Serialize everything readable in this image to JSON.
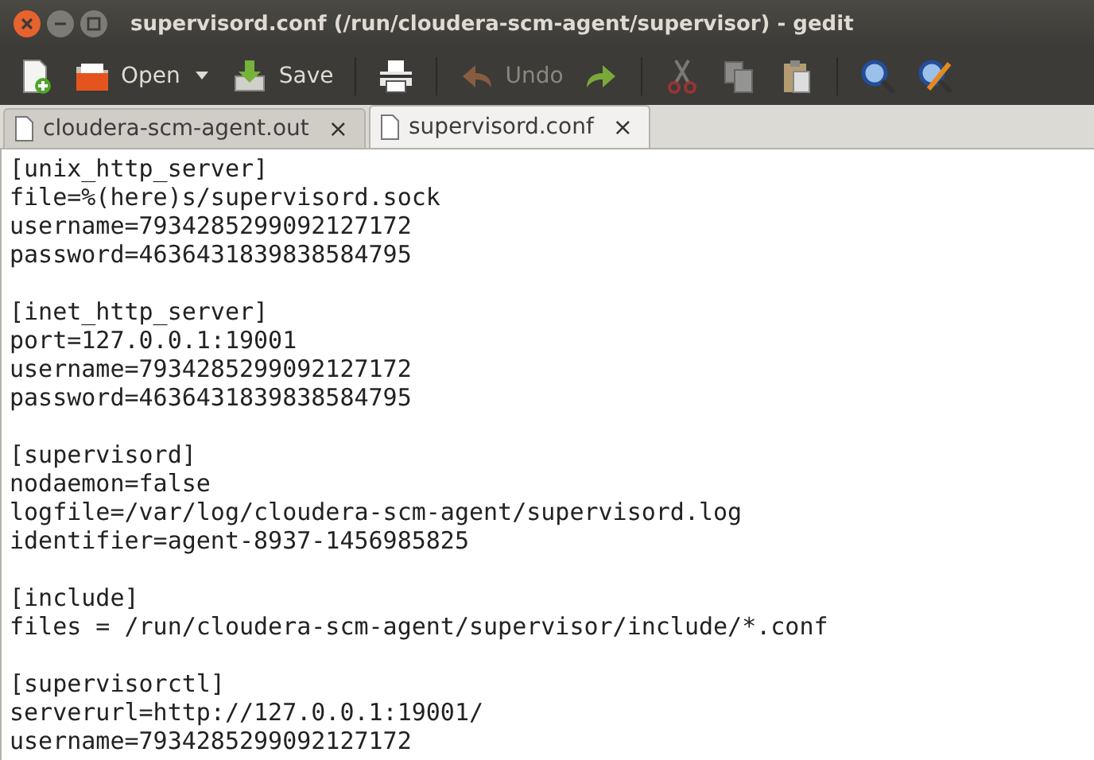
{
  "window": {
    "title": "supervisord.conf (/run/cloudera-scm-agent/supervisor) - gedit"
  },
  "toolbar": [
    {
      "kind": "new",
      "disabled": false
    },
    {
      "kind": "open",
      "label": "Open",
      "disabled": false,
      "dropdown": true
    },
    {
      "kind": "save",
      "label": "Save",
      "disabled": false
    },
    {
      "kind": "separator"
    },
    {
      "kind": "print",
      "disabled": false
    },
    {
      "kind": "separator"
    },
    {
      "kind": "undo",
      "label": "Undo",
      "disabled": true
    },
    {
      "kind": "redo",
      "disabled": false
    },
    {
      "kind": "separator"
    },
    {
      "kind": "cut",
      "disabled": true
    },
    {
      "kind": "copy",
      "disabled": true
    },
    {
      "kind": "paste",
      "disabled": false
    },
    {
      "kind": "separator"
    },
    {
      "kind": "find",
      "disabled": false
    },
    {
      "kind": "replace",
      "disabled": false
    }
  ],
  "tabs": [
    {
      "label": "cloudera-scm-agent.out",
      "selected": false,
      "close": "×"
    },
    {
      "label": "supervisord.conf",
      "selected": true,
      "close": "×"
    }
  ],
  "editor": {
    "sections": [
      [
        "[unix_http_server]",
        "file=%(here)s/supervisord.sock",
        "username=7934285299092127172",
        "password=4636431839838584795"
      ],
      [
        "[inet_http_server]",
        "port=127.0.0.1:19001",
        "username=7934285299092127172",
        "password=4636431839838584795"
      ],
      [
        "[supervisord]",
        "nodaemon=false",
        "logfile=/var/log/cloudera-scm-agent/supervisord.log",
        "identifier=agent-8937-1456985825"
      ],
      [
        "[include]",
        "files = /run/cloudera-scm-agent/supervisor/include/*.conf"
      ],
      [
        "[supervisorctl]",
        "serverurl=http://127.0.0.1:19001/",
        "username=7934285299092127172"
      ]
    ]
  }
}
